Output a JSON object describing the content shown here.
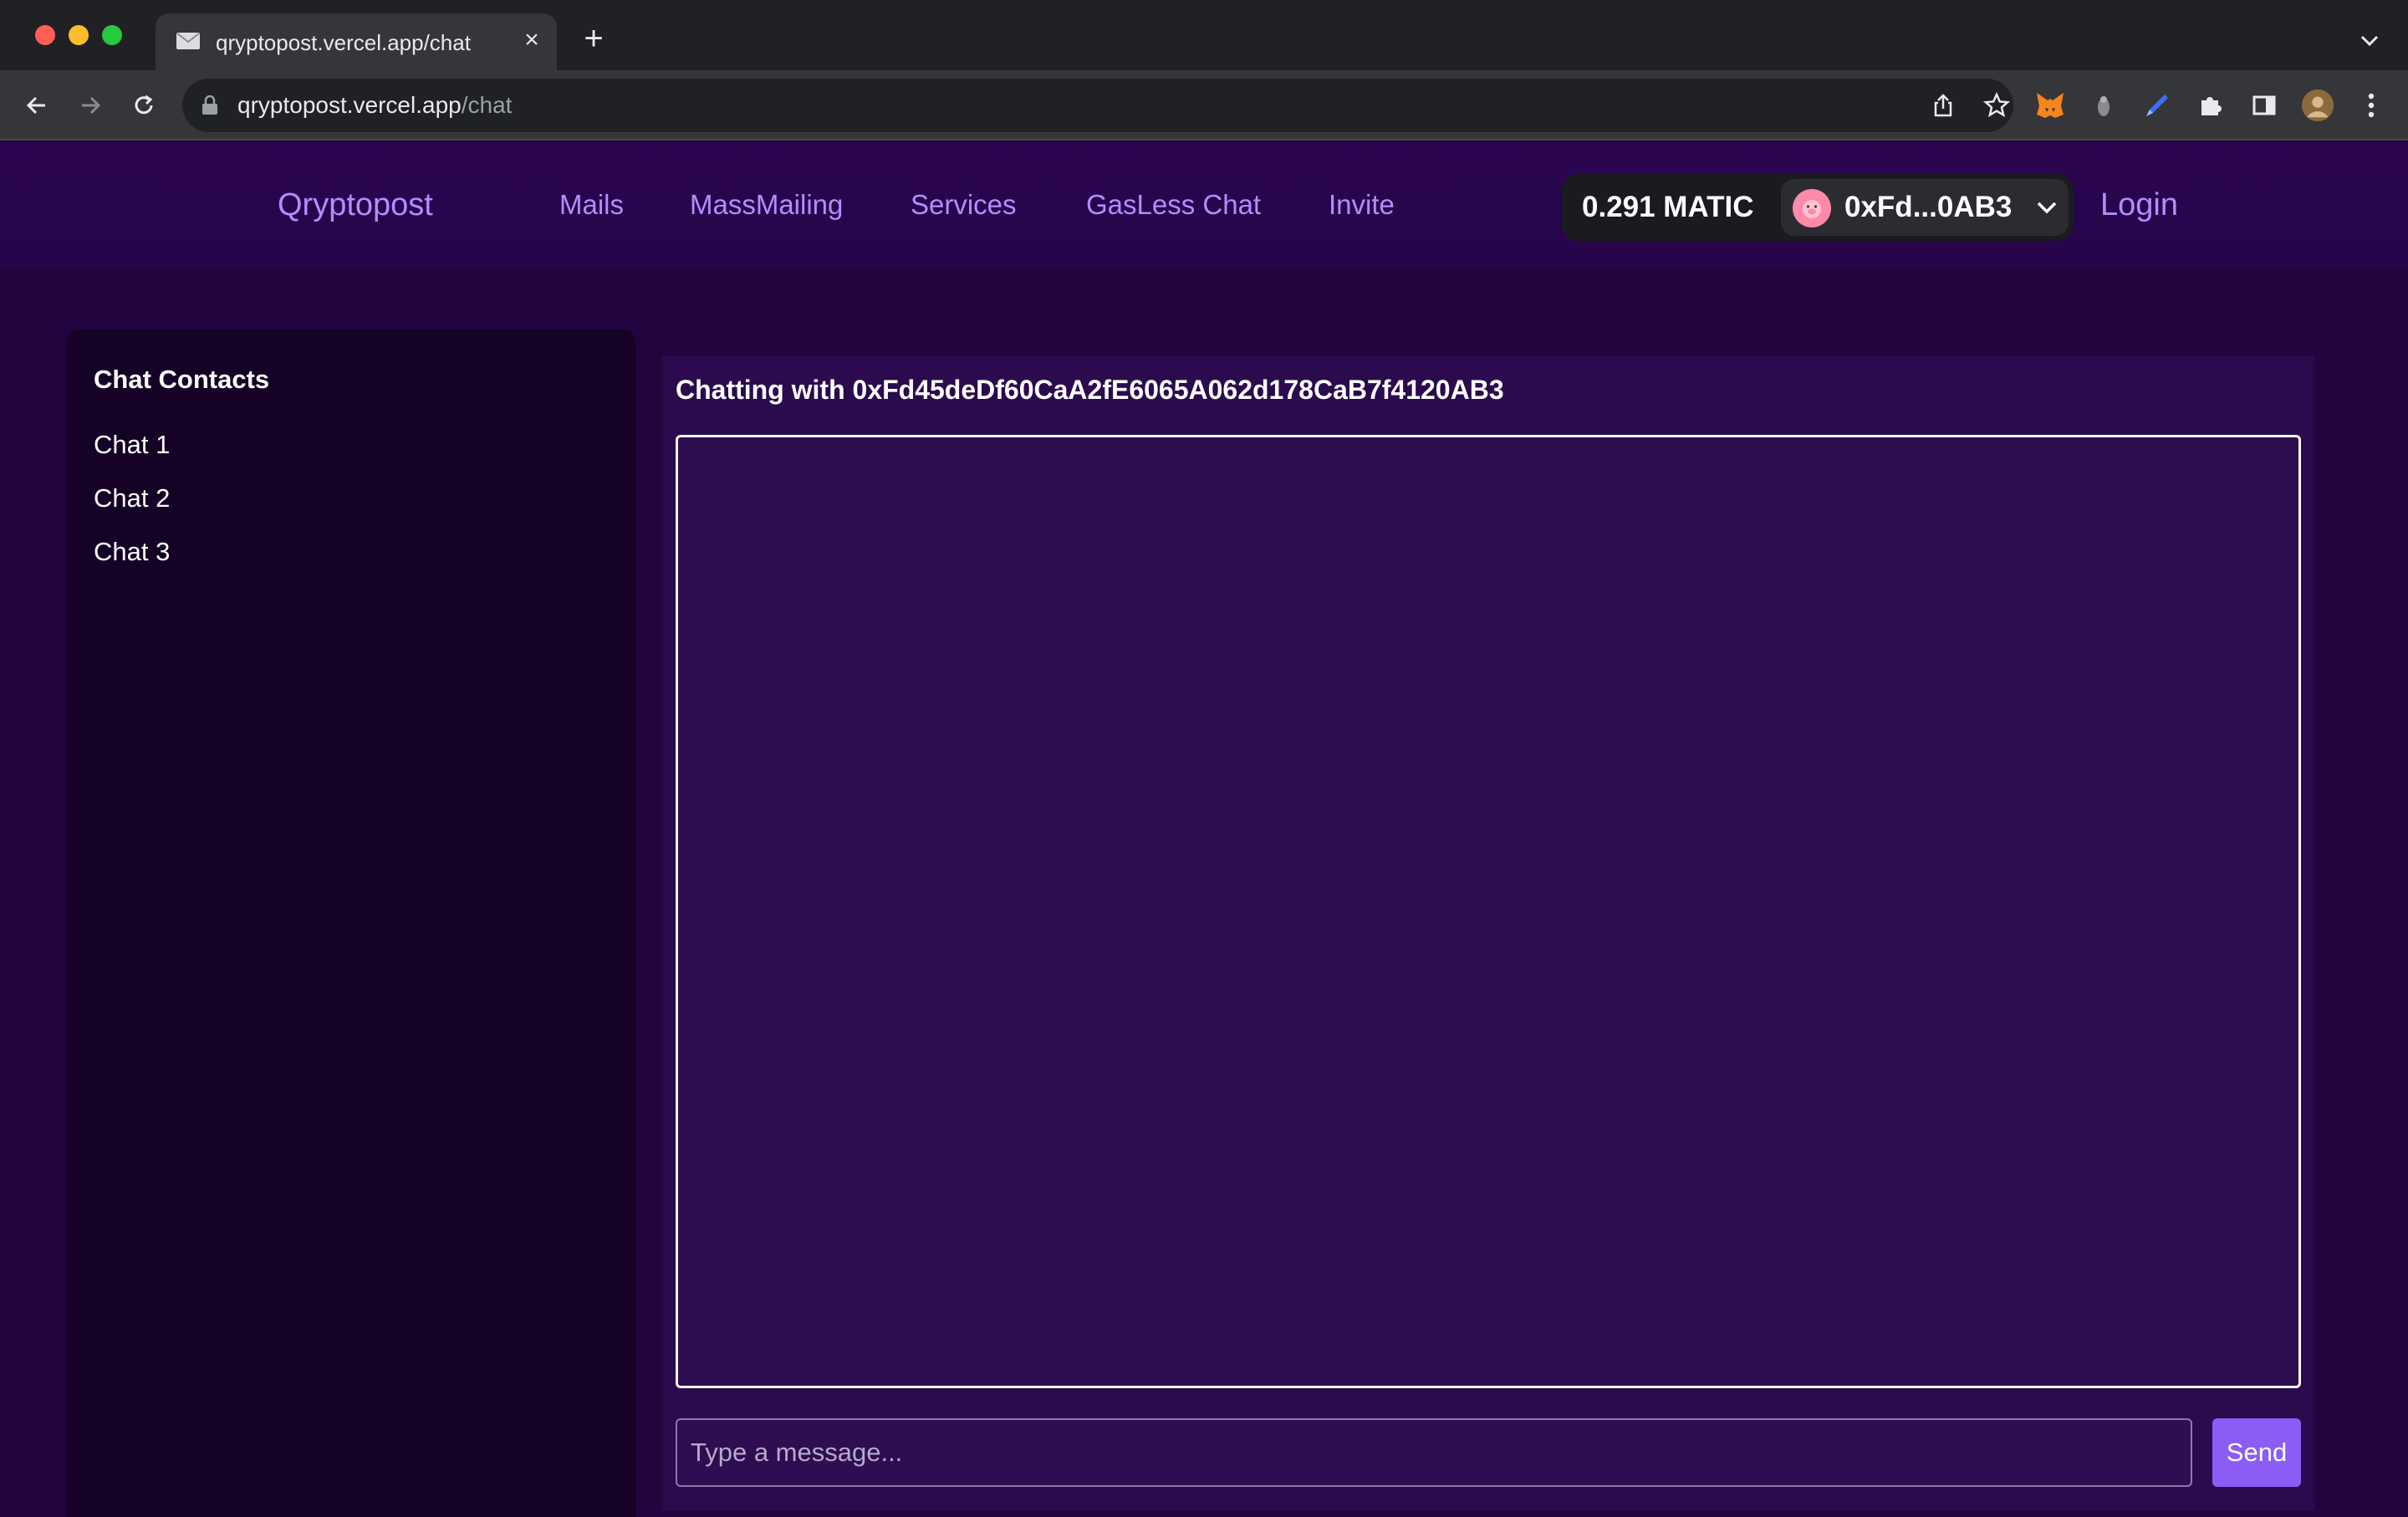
{
  "browser": {
    "tab_title": "qryptopost.vercel.app/chat",
    "url_host": "qryptopost.vercel.app",
    "url_path": "/chat"
  },
  "header": {
    "brand": "Qryptopost",
    "nav": [
      "Mails",
      "MassMailing",
      "Services",
      "GasLess Chat",
      "Invite"
    ],
    "wallet": {
      "balance": "0.291 MATIC",
      "account": "0xFd...0AB3"
    },
    "login": "Login"
  },
  "sidebar": {
    "title": "Chat Contacts",
    "contacts": [
      "Chat 1",
      "Chat 2",
      "Chat 3"
    ]
  },
  "chat": {
    "heading": "Chatting with 0xFd45deDf60CaA2fE6065A062d178CaB7f4120AB3",
    "input_placeholder": "Type a message...",
    "input_value": "",
    "send_label": "Send"
  },
  "colors": {
    "page_bg": "#22043f",
    "accent": "#b48cff",
    "send_button": "#8b5cf6"
  }
}
